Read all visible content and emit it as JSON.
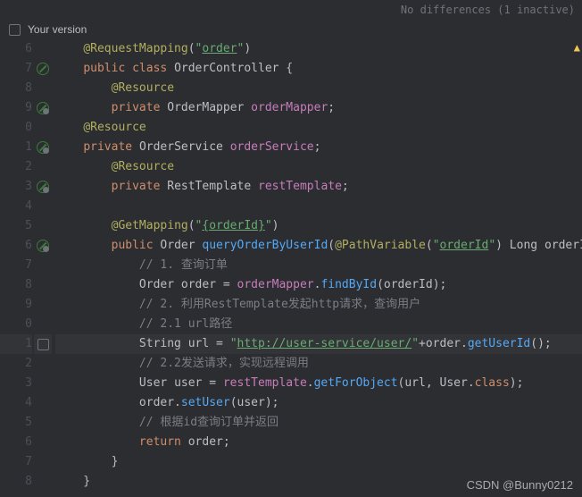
{
  "top_bar": {
    "diff_status": "No differences (1 inactive)"
  },
  "header": {
    "your_version": "Your version"
  },
  "watermark": "CSDN @Bunny0212",
  "lines": {
    "l6": {
      "num": "6",
      "icon": "",
      "html": "    <span class='anno'>@RequestMapping</span>(<span class='str'>\"</span><span class='str link'>order</span><span class='str'>\"</span>)"
    },
    "l7": {
      "num": "7",
      "icon": "circle",
      "html": "    <span class='kw'>public</span> <span class='kw'>class</span> <span class='cls'>OrderController</span> {"
    },
    "l8": {
      "num": "8",
      "icon": "",
      "html": "        <span class='anno'>@Resource</span>"
    },
    "l9": {
      "num": "9",
      "icon": "circle-dot",
      "html": "        <span class='kw'>private</span> <span class='cls'>OrderMapper</span> <span class='field'>orderMapper</span>;"
    },
    "l10": {
      "num": "0",
      "icon": "",
      "html": "    <span class='anno'>@Resource</span>"
    },
    "l11": {
      "num": "1",
      "icon": "circle-dot",
      "html": "    <span class='kw'>private</span> <span class='cls'>OrderService</span> <span class='field'>orderService</span>;"
    },
    "l12": {
      "num": "2",
      "icon": "",
      "html": "        <span class='anno'>@Resource</span>"
    },
    "l13": {
      "num": "3",
      "icon": "circle-dot",
      "html": "        <span class='kw'>private</span> <span class='cls'>RestTemplate</span> <span class='field'>restTemplate</span>;"
    },
    "l14": {
      "num": "4",
      "icon": "",
      "html": ""
    },
    "l15": {
      "num": "5",
      "icon": "",
      "html": "        <span class='anno'>@GetMapping</span>(<span class='str'>\"</span><span class='str link'>{orderId}</span><span class='str'>\"</span>)"
    },
    "l16": {
      "num": "6",
      "icon": "circle-dot",
      "html": "        <span class='kw'>public</span> <span class='cls'>Order</span> <span class='method'>queryOrderByUserId</span>(<span class='anno'>@PathVariable</span>(<span class='str'>\"</span><span class='str link'>orderId</span><span class='str'>\"</span>) <span class='cls'>Long</span> <span class='param'>orderId</span>) {"
    },
    "l17": {
      "num": "7",
      "icon": "",
      "html": "            <span class='comment'>// 1. 查询订单</span>"
    },
    "l18": {
      "num": "8",
      "icon": "",
      "html": "            <span class='cls'>Order</span> <span class='param'>order</span> = <span class='field'>orderMapper</span>.<span class='method'>findById</span>(<span class='param'>orderId</span>);"
    },
    "l19": {
      "num": "9",
      "icon": "",
      "html": "            <span class='comment'>// 2. 利用RestTemplate发起http请求，查询用户</span>"
    },
    "l20": {
      "num": "0",
      "icon": "",
      "html": "            <span class='comment'>// 2.1 url路径</span>"
    },
    "l21": {
      "num": "1",
      "icon": "check",
      "highlighted": true,
      "html": "            <span class='cls'>String</span> <span class='param'>url</span> = <span class='str'>\"</span><span class='link2'>http://user-service/user/</span><span class='str'>\"</span>+order.<span class='method'>getUserId</span>();"
    },
    "l22": {
      "num": "2",
      "icon": "",
      "html": "            <span class='comment'>// 2.2发送请求，实现远程调用</span>"
    },
    "l23": {
      "num": "3",
      "icon": "",
      "html": "            <span class='cls'>User</span> <span class='param'>user</span> = <span class='field'>restTemplate</span>.<span class='method'>getForObject</span>(url, <span class='cls'>User</span>.<span class='kw'>class</span>);"
    },
    "l24": {
      "num": "4",
      "icon": "",
      "html": "            order.<span class='method'>setUser</span>(<span class='param'>user</span>);"
    },
    "l25": {
      "num": "5",
      "icon": "",
      "html": "            <span class='comment'>// 根据id查询订单并返回</span>"
    },
    "l26": {
      "num": "6",
      "icon": "",
      "html": "            <span class='kw'>return</span> order;"
    },
    "l27": {
      "num": "7",
      "icon": "",
      "html": "        }"
    },
    "l28": {
      "num": "8",
      "icon": "",
      "html": "    }"
    }
  },
  "line_order": [
    "l6",
    "l7",
    "l8",
    "l9",
    "l10",
    "l11",
    "l12",
    "l13",
    "l14",
    "l15",
    "l16",
    "l17",
    "l18",
    "l19",
    "l20",
    "l21",
    "l22",
    "l23",
    "l24",
    "l25",
    "l26",
    "l27",
    "l28"
  ]
}
